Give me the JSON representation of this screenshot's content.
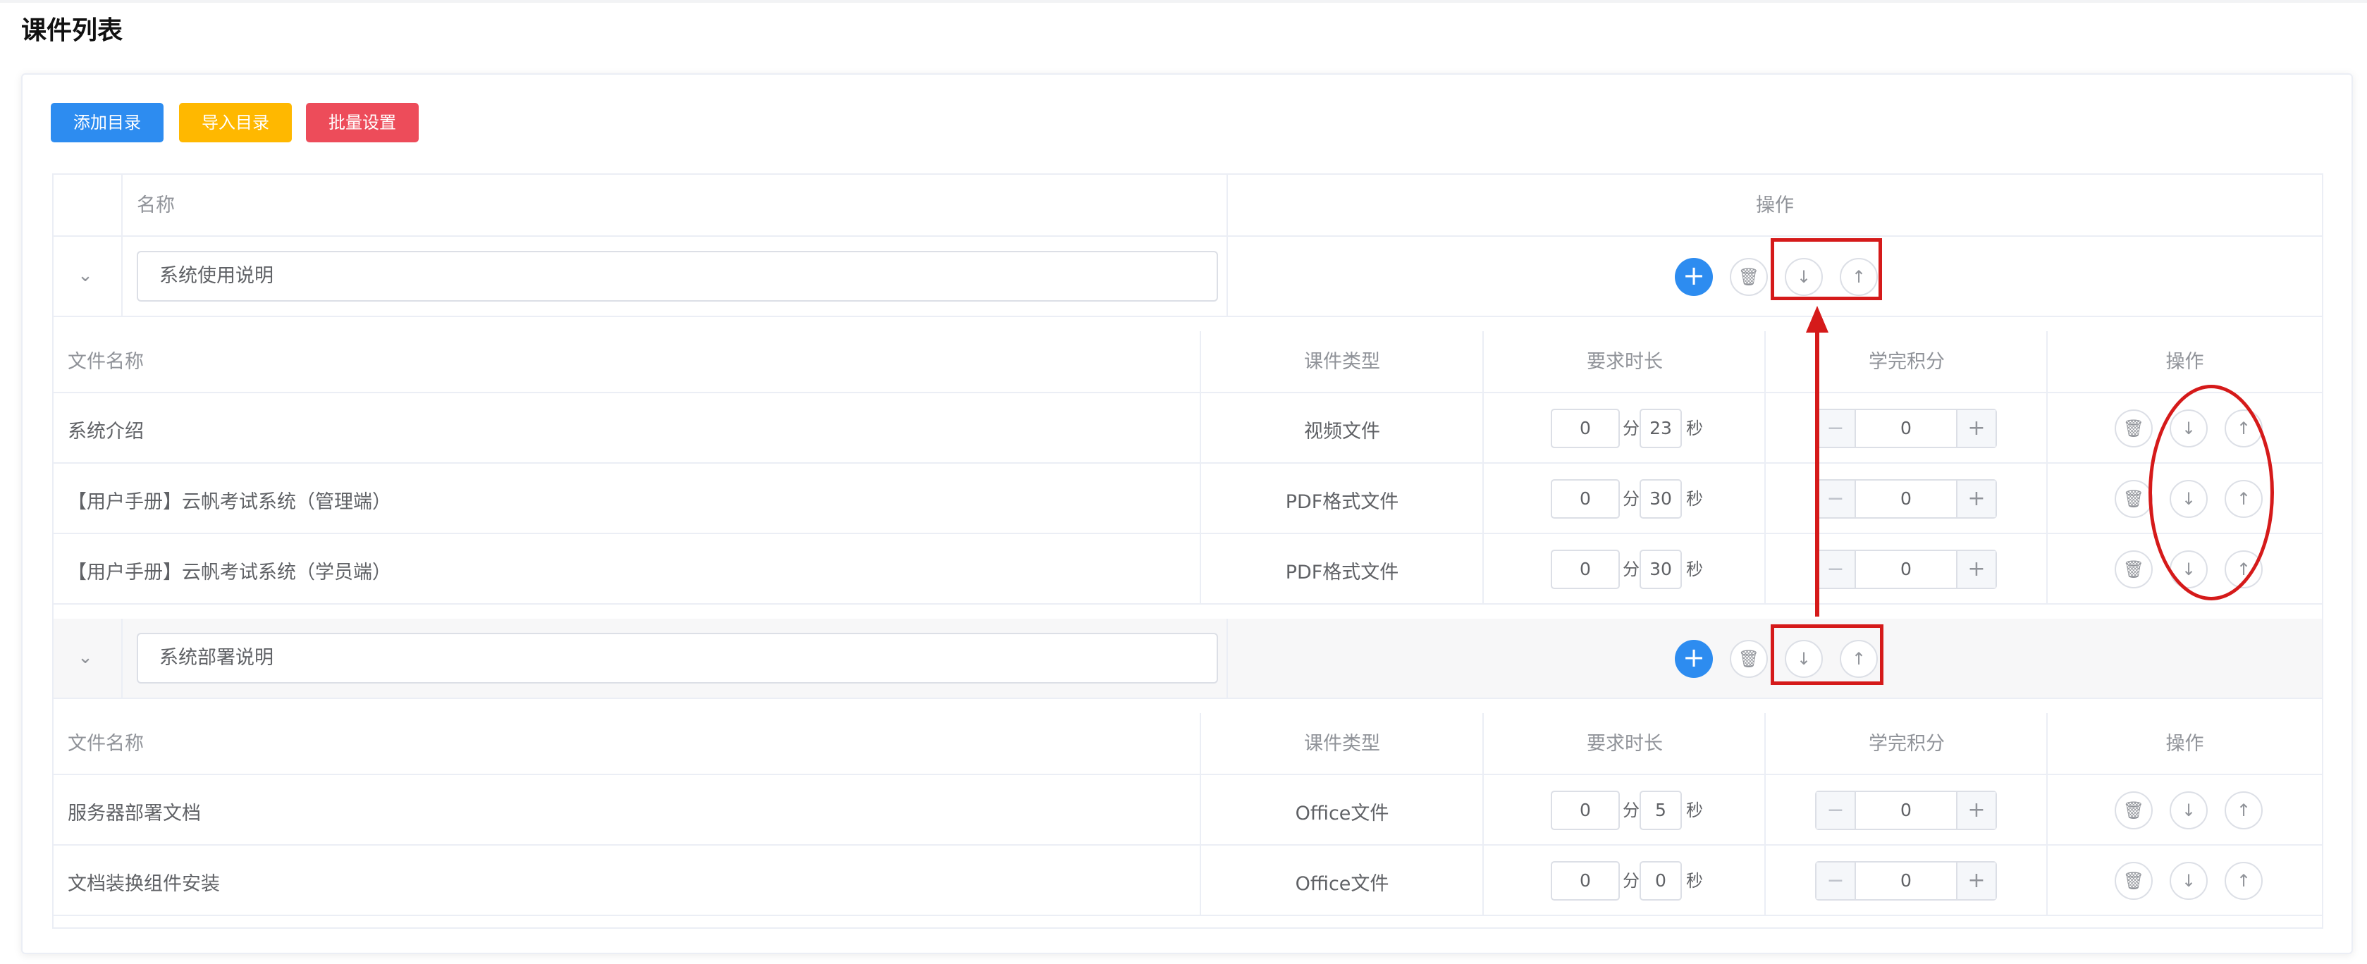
{
  "page": {
    "title": "课件列表"
  },
  "toolbar": {
    "add_dir": "添加目录",
    "import_dir": "导入目录",
    "batch_settings": "批量设置"
  },
  "table": {
    "headers": {
      "name": "名称",
      "actions": "操作"
    },
    "sub_headers": {
      "file_name": "文件名称",
      "type": "课件类型",
      "duration": "要求时长",
      "points": "学完积分",
      "actions": "操作"
    },
    "units": {
      "minute": "分",
      "second": "秒"
    },
    "icons": {
      "expand": "chevron-down-icon",
      "add": "plus-icon",
      "delete": "trash-icon",
      "move_down": "arrow-down-icon",
      "move_up": "arrow-up-icon",
      "minus": "minus-icon"
    },
    "directories": [
      {
        "name": "系统使用说明",
        "files": [
          {
            "name": "系统介绍",
            "type": "视频文件",
            "minutes": "0",
            "seconds": "23",
            "points": "0"
          },
          {
            "name": "【用户手册】云帆考试系统（管理端）",
            "type": "PDF格式文件",
            "minutes": "0",
            "seconds": "30",
            "points": "0"
          },
          {
            "name": "【用户手册】云帆考试系统（学员端）",
            "type": "PDF格式文件",
            "minutes": "0",
            "seconds": "30",
            "points": "0"
          }
        ]
      },
      {
        "name": "系统部署说明",
        "files": [
          {
            "name": "服务器部署文档",
            "type": "Office文件",
            "minutes": "0",
            "seconds": "5",
            "points": "0"
          },
          {
            "name": "文档装换组件安装",
            "type": "Office文件",
            "minutes": "0",
            "seconds": "0",
            "points": "0"
          }
        ]
      }
    ]
  },
  "colors": {
    "primary": "#2d8cf0",
    "warning": "#ffb800",
    "danger": "#ed4c5a",
    "annotation": "#d51a1a"
  }
}
